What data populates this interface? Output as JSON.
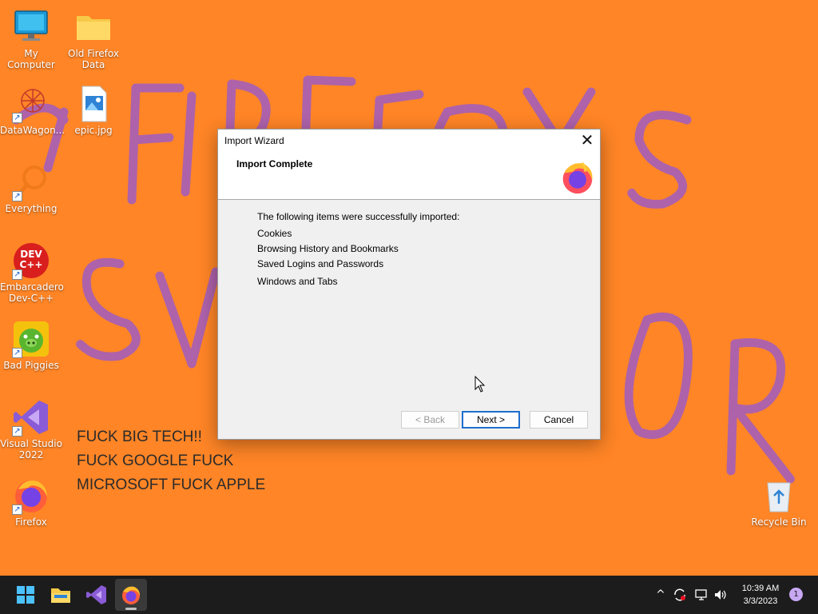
{
  "desktop": {
    "icons": [
      {
        "label": "My Computer"
      },
      {
        "label": "Old Firefox Data"
      },
      {
        "label": "DataWagon..."
      },
      {
        "label": "epic.jpg"
      },
      {
        "label": "Everything"
      },
      {
        "label": "Embarcadero Dev-C++"
      },
      {
        "label": "Bad Piggies"
      },
      {
        "label": "Visual Studio 2022"
      },
      {
        "label": "Firefox"
      },
      {
        "label": "Recycle Bin"
      }
    ],
    "devcpp_logo_text": "DEV C++",
    "wall_text": [
      "FUCK BIG TECH!!",
      "FUCK GOOGLE FUCK",
      "MICROSOFT FUCK APPLE"
    ]
  },
  "dialog": {
    "title": "Import Wizard",
    "heading": "Import Complete",
    "intro": "The following items were successfully imported:",
    "items": [
      "Cookies",
      "Browsing History and Bookmarks",
      "Saved Logins and Passwords",
      "Windows and Tabs"
    ],
    "close_glyph": "✕",
    "buttons": {
      "back": "< Back",
      "next": "Next >",
      "cancel": "Cancel"
    }
  },
  "taskbar": {
    "pinned": [
      "start-icon",
      "file-explorer-icon",
      "visual-studio-icon",
      "firefox-icon"
    ],
    "tray": {
      "chevron": "^",
      "time": "10:39 AM",
      "date": "3/3/2023",
      "notification_count": "1"
    }
  },
  "colors": {
    "desktop_bg": "#ff8526",
    "scribble": "#a05cc2",
    "taskbar_bg": "#1c1c1c",
    "accent": "#1f6fcf"
  }
}
